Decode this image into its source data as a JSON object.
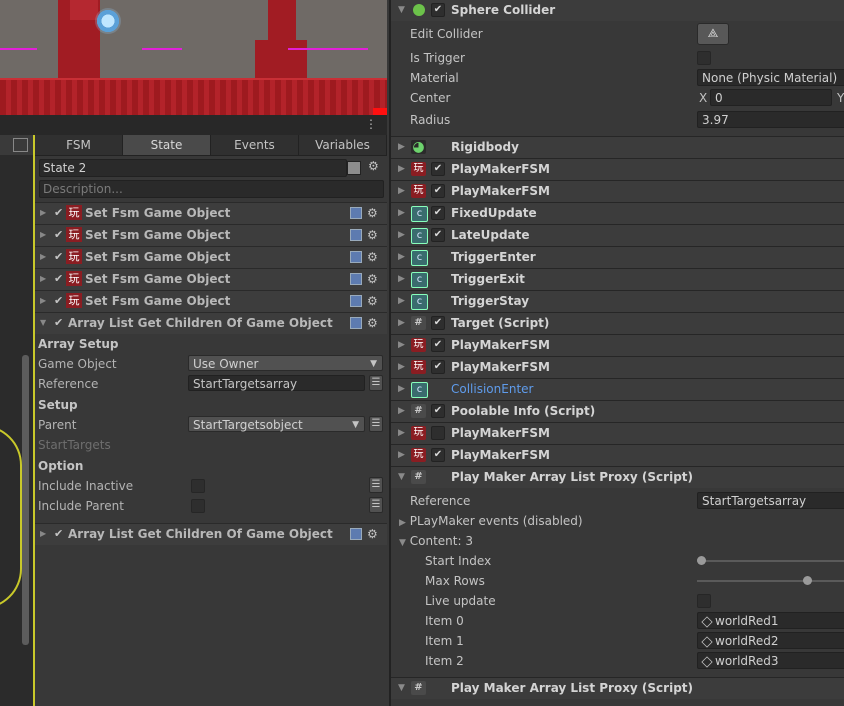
{
  "colors": {
    "accent_yellow": "#c9c92a",
    "link_blue": "#5f9cec",
    "playmaker_red": "#8a1d22"
  },
  "left_panel": {
    "tabs": [
      {
        "label": "FSM",
        "active": false
      },
      {
        "label": "State",
        "active": true
      },
      {
        "label": "Events",
        "active": false
      },
      {
        "label": "Variables",
        "active": false
      }
    ],
    "state_name": "State 2",
    "description_placeholder": "Description...",
    "actions": [
      {
        "label": "Set Fsm Game Object",
        "icon": "playmaker-icon"
      },
      {
        "label": "Set Fsm Game Object",
        "icon": "playmaker-icon"
      },
      {
        "label": "Set Fsm Game Object",
        "icon": "playmaker-icon"
      },
      {
        "label": "Set Fsm Game Object",
        "icon": "playmaker-icon"
      },
      {
        "label": "Set Fsm Game Object",
        "icon": "playmaker-icon"
      }
    ],
    "expanded_action": {
      "label": "Array List Get Children Of Game Object",
      "array_setup_header": "Array Setup",
      "game_object_label": "Game Object",
      "game_object_value": "Use Owner",
      "reference_label": "Reference",
      "reference_value": "StartTargetsarray",
      "setup_header": "Setup",
      "parent_label": "Parent",
      "parent_value": "StartTargetsobject",
      "result_placeholder": "StartTargets",
      "option_header": "Option",
      "include_inactive_label": "Include Inactive",
      "include_parent_label": "Include Parent"
    },
    "last_action": {
      "label": "Array List Get Children Of Game Object"
    }
  },
  "inspector": {
    "sphere_collider": {
      "title": "Sphere Collider",
      "edit_collider_label": "Edit Collider",
      "is_trigger_label": "Is Trigger",
      "material_label": "Material",
      "material_value": "None (Physic Material)",
      "center_label": "Center",
      "center_x_axis": "X",
      "center_x_value": "0",
      "center_y_axis": "Y",
      "radius_label": "Radius",
      "radius_value": "3.97"
    },
    "components": [
      {
        "name": "Rigidbody",
        "icon": "rigidbody-icon",
        "checkbox": null,
        "style": "bold"
      },
      {
        "name": "PlayMakerFSM",
        "icon": "playmaker-icon",
        "checkbox": true,
        "style": "bold"
      },
      {
        "name": "PlayMakerFSM",
        "icon": "playmaker-icon",
        "checkbox": true,
        "style": "bold"
      },
      {
        "name": "FixedUpdate",
        "icon": "csharp-icon",
        "checkbox": true,
        "style": "bold"
      },
      {
        "name": "LateUpdate",
        "icon": "csharp-icon",
        "checkbox": true,
        "style": "bold"
      },
      {
        "name": "TriggerEnter",
        "icon": "csharp-icon",
        "checkbox": null,
        "style": "bold"
      },
      {
        "name": "TriggerExit",
        "icon": "csharp-icon",
        "checkbox": null,
        "style": "bold"
      },
      {
        "name": "TriggerStay",
        "icon": "csharp-icon",
        "checkbox": null,
        "style": "bold"
      },
      {
        "name": "Target (Script)",
        "icon": "script-icon",
        "checkbox": true,
        "style": "bold"
      },
      {
        "name": "PlayMakerFSM",
        "icon": "playmaker-icon",
        "checkbox": true,
        "style": "bold"
      },
      {
        "name": "PlayMakerFSM",
        "icon": "playmaker-icon",
        "checkbox": true,
        "style": "bold"
      },
      {
        "name": "CollisionEnter",
        "icon": "csharp-icon",
        "checkbox": null,
        "style": "link"
      },
      {
        "name": "Poolable Info (Script)",
        "icon": "script-icon",
        "checkbox": true,
        "style": "bold"
      },
      {
        "name": "PlayMakerFSM",
        "icon": "playmaker-icon",
        "checkbox": false,
        "style": "bold"
      },
      {
        "name": "PlayMakerFSM",
        "icon": "playmaker-icon",
        "checkbox": true,
        "style": "bold"
      }
    ],
    "array_proxy": {
      "title": "Play Maker Array List Proxy (Script)",
      "reference_label": "Reference",
      "reference_value": "StartTargetsarray",
      "events_label": "PLayMaker events (disabled)",
      "content_label": "Content: 3",
      "start_index_label": "Start Index",
      "start_index_fraction": 0.0,
      "max_rows_label": "Max Rows",
      "max_rows_fraction": 0.76,
      "live_update_label": "Live update",
      "items": [
        {
          "label": "Item 0",
          "value": "worldRed1"
        },
        {
          "label": "Item 1",
          "value": "worldRed2"
        },
        {
          "label": "Item 2",
          "value": "worldRed3"
        }
      ]
    },
    "array_proxy_2": {
      "title": "Play Maker Array List Proxy (Script)"
    }
  }
}
